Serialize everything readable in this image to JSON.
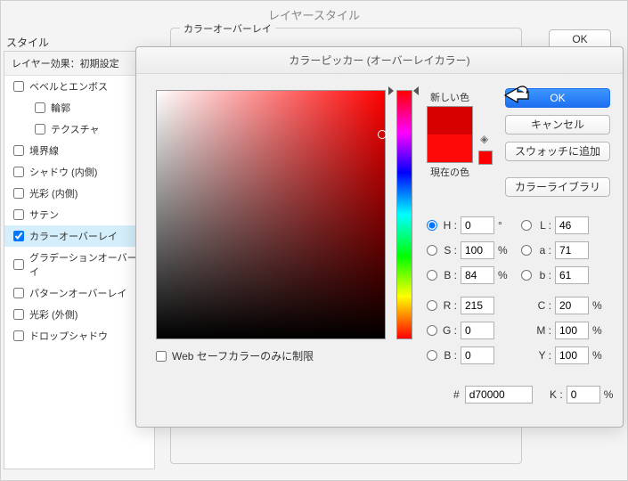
{
  "parent": {
    "title": "レイヤースタイル",
    "style_header": "スタイル",
    "subheader": "レイヤー効果：初期設定",
    "items": [
      {
        "label": "ベベルとエンボス",
        "checked": false,
        "indent": false,
        "selected": false
      },
      {
        "label": "輪郭",
        "checked": false,
        "indent": true,
        "selected": false
      },
      {
        "label": "テクスチャ",
        "checked": false,
        "indent": true,
        "selected": false
      },
      {
        "label": "境界線",
        "checked": false,
        "indent": false,
        "selected": false
      },
      {
        "label": "シャドウ (内側)",
        "checked": false,
        "indent": false,
        "selected": false
      },
      {
        "label": "光彩 (内側)",
        "checked": false,
        "indent": false,
        "selected": false
      },
      {
        "label": "サテン",
        "checked": false,
        "indent": false,
        "selected": false
      },
      {
        "label": "カラーオーバーレイ",
        "checked": true,
        "indent": false,
        "selected": true
      },
      {
        "label": "グラデーションオーバーレイ",
        "checked": false,
        "indent": false,
        "selected": false
      },
      {
        "label": "パターンオーバーレイ",
        "checked": false,
        "indent": false,
        "selected": false
      },
      {
        "label": "光彩 (外側)",
        "checked": false,
        "indent": false,
        "selected": false
      },
      {
        "label": "ドロップシャドウ",
        "checked": false,
        "indent": false,
        "selected": false
      }
    ],
    "groupbox": "カラーオーバーレイ",
    "ok": "OK"
  },
  "picker": {
    "title": "カラーピッカー (オーバーレイカラー)",
    "new_label": "新しい色",
    "current_label": "現在の色",
    "buttons": {
      "ok": "OK",
      "cancel": "キャンセル",
      "add_swatch": "スウォッチに追加",
      "libraries": "カラーライブラリ"
    },
    "websafe": "Web セーフカラーのみに制限",
    "fields": {
      "H": {
        "label": "H :",
        "value": "0",
        "unit": "°"
      },
      "S": {
        "label": "S :",
        "value": "100",
        "unit": "%"
      },
      "Bv": {
        "label": "B :",
        "value": "84",
        "unit": "%"
      },
      "R": {
        "label": "R :",
        "value": "215"
      },
      "G": {
        "label": "G :",
        "value": "0"
      },
      "Bb": {
        "label": "B :",
        "value": "0"
      },
      "L": {
        "label": "L :",
        "value": "46"
      },
      "a": {
        "label": "a :",
        "value": "71"
      },
      "b": {
        "label": "b :",
        "value": "61"
      },
      "C": {
        "label": "C :",
        "value": "20",
        "unit": "%"
      },
      "M": {
        "label": "M :",
        "value": "100",
        "unit": "%"
      },
      "Y": {
        "label": "Y :",
        "value": "100",
        "unit": "%"
      },
      "K": {
        "label": "K :",
        "value": "0",
        "unit": "%"
      },
      "hex_label": "#",
      "hex": "d70000"
    },
    "colors": {
      "new": "#d70000",
      "current": "#ff0808"
    }
  }
}
